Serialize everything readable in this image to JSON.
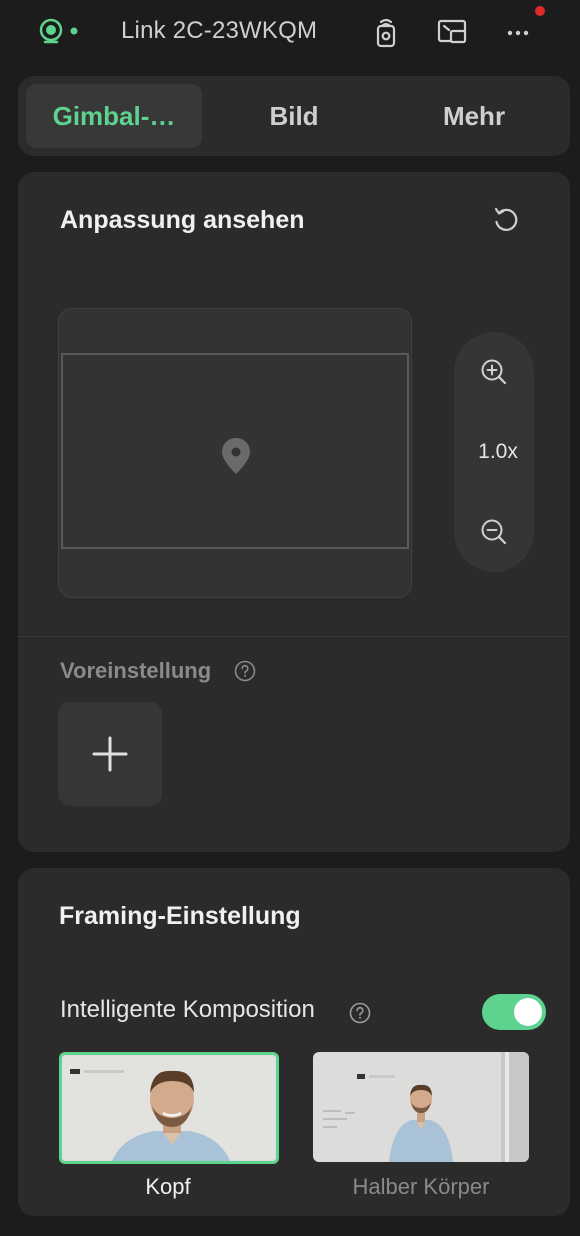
{
  "topbar": {
    "status_icon": "camera-live-icon",
    "device_name": "Link 2C-23WKQM",
    "icons": [
      "remote-control-icon",
      "screen-cast-icon",
      "more-options-icon"
    ],
    "notification_color": "#e02b2b"
  },
  "tabs": [
    {
      "label": "Gimbal-…",
      "active": true
    },
    {
      "label": "Bild",
      "active": false
    },
    {
      "label": "Mehr",
      "active": false
    }
  ],
  "view": {
    "title": "Anpassung ansehen",
    "zoom": "1.0x",
    "preset_label": "Voreinstellung"
  },
  "framing": {
    "title": "Framing-Einstellung",
    "smart_composition_label": "Intelligente Komposition",
    "smart_composition_on": true,
    "options": [
      {
        "label": "Kopf",
        "selected": true
      },
      {
        "label": "Halber Körper",
        "selected": false
      }
    ]
  },
  "colors": {
    "accent": "#5ed28f",
    "background": "#1c1c1c",
    "card": "#2b2b2b"
  }
}
